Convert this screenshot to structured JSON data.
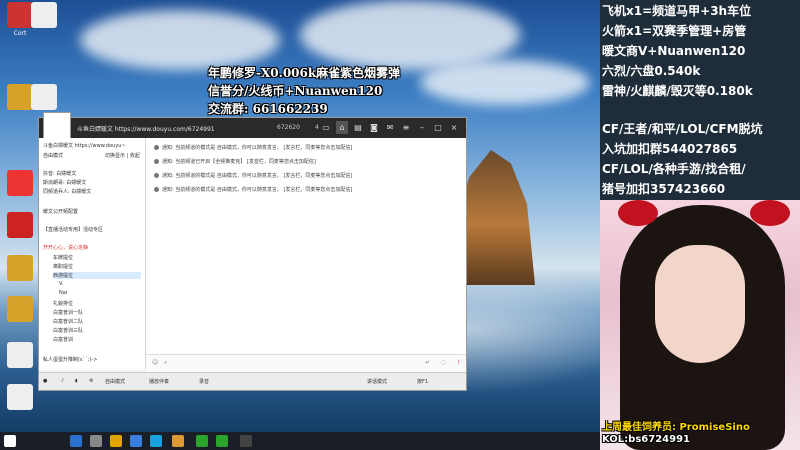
{
  "stream_overlay": {
    "line1": "年鹏修罗-X0.006k麻雀紫色烟雾弹",
    "line2": "信誉分/火线币+Nuanwen120",
    "line3": "交流群: 661662239"
  },
  "side_panel": {
    "lines": [
      "飞机x1=频道马甲+3h车位",
      "火箭x1=双赛季管理+房管",
      "暖文商V+Nuanwen120",
      "六烈/六盘0.540k",
      "雷神/火麒麟/毁灭等0.180k",
      "CF/王者/和平/LOL/CFM脱坑",
      "入坑加扣群544027865",
      "CF/LOL/各种手游/找合租/",
      "猪号加扣357423660"
    ],
    "caption_line1": "上周最佳饲养员: PromiseSino",
    "caption_line2": "KOL:bs6724991"
  },
  "app_window": {
    "url": "斗鱼白嫖暖文 https://www.douyu.com/6724991",
    "count": "672620",
    "rc": "4",
    "left_pane": {
      "header": "斗鱼白嫖暖文 https://www.douyu~",
      "mode": "自由模式",
      "ctrl": "切换显示 | 收起",
      "items": [
        "抖音: 白嫖暖文",
        "斯派朗哥: 白嫖暖文",
        "同频道兵人: 白嫖暖文",
        "暖文公开频配置",
        "【直播活动专用】活动专区",
        "开开心心，说心定静",
        "车牌提位",
        "离职提位",
        "西游提位",
        "V.",
        "Nai",
        "礼貌排位",
        "白富普训一队",
        "白富普训二队",
        "白富普训三队",
        "白富普训",
        "私人蛋蛋升降制(ε`´;)->"
      ]
    },
    "messages": [
      "通知: 当前频道的模式是 自由模式，你可以随意发言。 [发言栏，同麦等您点击加配信]",
      "通知: 当前频道已开启【全频推麦克】 [发音栏，同麦等您点击加配信]",
      "通知: 当前频道的模式是 自由模式，你可以随意发言。 [发言栏，同麦等您点击加配信]",
      "通知: 当前频道的模式是 自由模式，你可以随意发言。 [发言栏，同麦等您点击加配信]"
    ],
    "bottom_bar": {
      "mode": "自由模式",
      "play": "播放伴奏",
      "record": "录音",
      "status": "讲话模式",
      "hotkey": "按F1"
    }
  },
  "desktop_icons": [
    {
      "label": "Cort",
      "color": "#c33"
    },
    {
      "label": "",
      "color": "#ddd"
    },
    {
      "label": "",
      "color": "#d8a12a"
    },
    {
      "label": "",
      "color": "#d8a12a"
    },
    {
      "label": "",
      "color": "#e33"
    },
    {
      "label": "",
      "color": "#d8a12a"
    }
  ]
}
